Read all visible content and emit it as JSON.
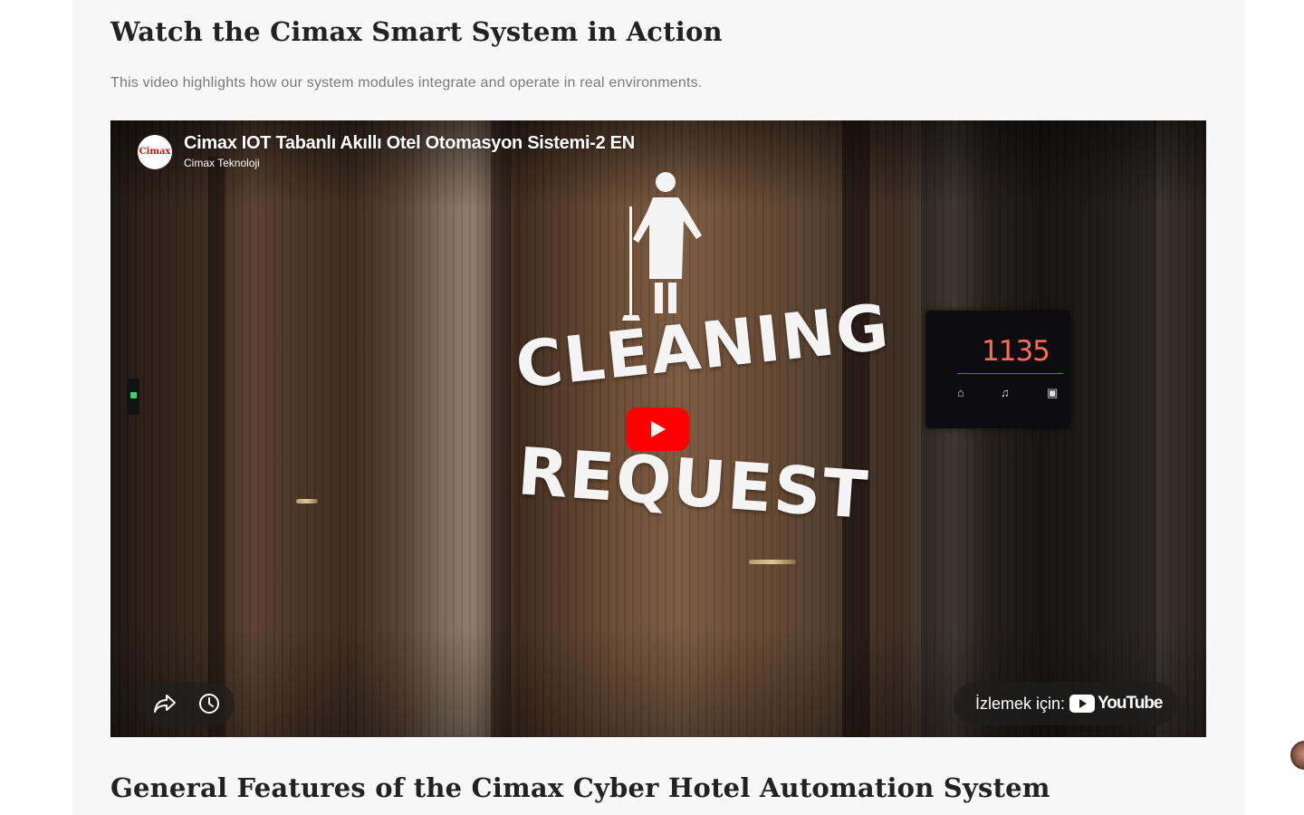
{
  "section1": {
    "title": "Watch the Cimax Smart System in Action",
    "subtitle": "This video highlights how our system modules integrate and operate in real environments."
  },
  "video": {
    "title": "Cimax IOT Tabanlı Akıllı Otel Otomasyon Sistemi-2 EN",
    "channel": "Cimax Teknoloji",
    "channel_logo_text": "Cimax",
    "scene_text_line1": "CLEANING",
    "scene_text_line2": "REQUEST",
    "panel_room_number": "1135",
    "watch_on_label": "İzlemek için:",
    "youtube_wordmark": "YouTube",
    "icons": [
      "play-icon",
      "share-icon",
      "clock-icon",
      "youtube-logo-icon"
    ]
  },
  "section2": {
    "title": "General Features of the Cimax Cyber Hotel Automation System"
  },
  "colors": {
    "page_background": "#f7f7f7",
    "heading": "#222222",
    "subtitle": "#7a7a7a",
    "youtube_red": "#ff0000"
  }
}
